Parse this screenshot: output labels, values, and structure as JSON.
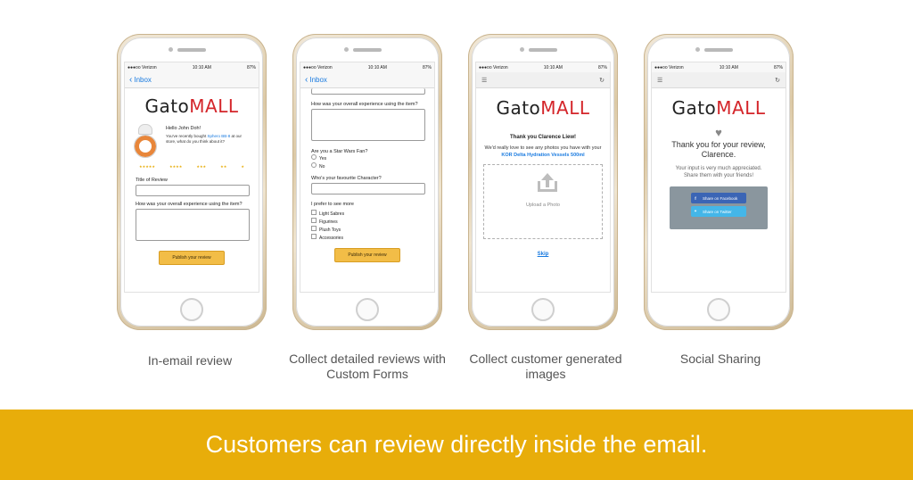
{
  "status": {
    "carrier": "●●●oo Verizon",
    "time": "10:10 AM",
    "battery": "87%"
  },
  "nav": {
    "back": "Inbox"
  },
  "logo": {
    "gato": "Gato",
    "mall": "MALL"
  },
  "phone1": {
    "greeting": "Hello John Doh!",
    "intro_pre": "You've recently bought ",
    "product": "Sphero BB-8",
    "intro_post": " at our store, what do you think about it?",
    "stars": [
      "★★★★★",
      "★★★★",
      "★★★",
      "★★",
      "★"
    ],
    "title_label": "Title of Review",
    "experience_label": "How was your overall experience using the item?",
    "button": "Publish your review"
  },
  "phone2": {
    "experience_label": "How was your overall experience using the item?",
    "fan_label": "Are you a Star Wars Fan?",
    "fan_options": [
      "Yes",
      "No"
    ],
    "character_label": "Who's your favourite Character?",
    "prefer_label": "I prefer to see more",
    "prefer_options": [
      "Light Sabres",
      "Figurines",
      "Plush Toys",
      "Accessories"
    ],
    "button": "Publish your review"
  },
  "phone3": {
    "thanks": "Thank you Clarence Liew!",
    "intro": "We'd really love to see any photos you have with your",
    "product": "KOR Delta Hydration Vessels 500ml",
    "upload": "Upload a Photo",
    "skip": "Skip"
  },
  "phone4": {
    "thanks": "Thank you for your review, Clarence.",
    "message": "Your input is very much appreciated. Share them with your friends!",
    "facebook": "Share on Facebook",
    "twitter": "Share on Twitter"
  },
  "captions": [
    "In-email review",
    "Collect detailed reviews with Custom Forms",
    "Collect customer generated images",
    "Social Sharing"
  ],
  "banner": "Customers can review directly inside the email.",
  "colors": {
    "banner": "#e8ad0a",
    "accent_red": "#d4252a",
    "link_blue": "#1a7be0",
    "button_yellow": "#f2bd47"
  }
}
